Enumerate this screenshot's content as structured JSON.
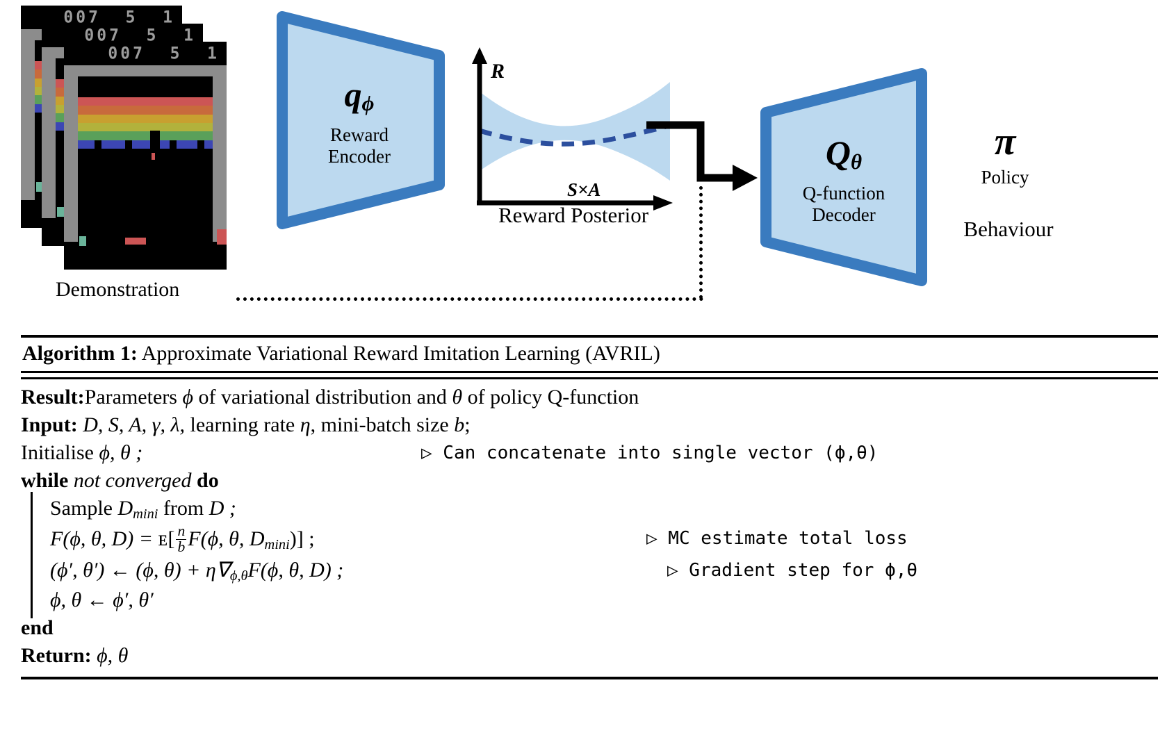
{
  "diagram": {
    "demonstration": {
      "label": "Demonstration",
      "frames": [
        {
          "score": "007  5  1"
        },
        {
          "score": "007  5  1"
        },
        {
          "score": "007  5  1"
        }
      ],
      "brick_colors": [
        "#cc5555",
        "#c86a3c",
        "#c8a030",
        "#b2b23c",
        "#5aa05a",
        "#3c46b4"
      ],
      "game": "Breakout"
    },
    "encoder": {
      "symbol": "q",
      "subscript": "ϕ",
      "line1": "Reward",
      "line2": "Encoder",
      "border_color": "#3a7bbf",
      "fill_color": "#bcd9ef"
    },
    "posterior": {
      "y_axis_label": "R",
      "x_axis_label": "S×A",
      "caption": "Reward Posterior",
      "band_color": "#bcd9ef",
      "mean_color": "#2c4f9e"
    },
    "decoder": {
      "symbol": "Q",
      "subscript": "θ",
      "line1": "Q-function",
      "line2": "Decoder",
      "border_color": "#3a7bbf",
      "fill_color": "#bcd9ef"
    },
    "policy": {
      "symbol": "π",
      "label": "Policy",
      "behaviour": "Behaviour"
    }
  },
  "algorithm": {
    "title_prefix": "Algorithm 1:",
    "title_text": "Approximate Variational Reward Imitation Learning (AVRIL)",
    "lines": {
      "result_kw": "Result:",
      "result_a": "Parameters ",
      "result_phi": "ϕ",
      "result_b": " of variational distribution and ",
      "result_theta": "θ",
      "result_c": " of policy Q-function",
      "input_kw": "Input:",
      "input_sets": "D, S, A, γ, λ,",
      "input_rate": " learning rate ",
      "input_eta": "η",
      "input_batch": ", mini-batch size ",
      "input_b": "b",
      "input_semi": ";",
      "init_text": "Initialise ",
      "init_params": "ϕ, θ ;",
      "init_comment": "▷ Can concatenate into single vector (ϕ,θ)",
      "while_kw": "while",
      "while_cond": "not converged",
      "do_kw": "do",
      "sample_a": "Sample ",
      "sample_D": "D",
      "sample_sub": "mini",
      "sample_b": " from ",
      "sample_D2": "D ;",
      "loss_lhs": "F(ϕ, θ, D) = ",
      "loss_E": "ᴇ",
      "loss_frac_num": "n",
      "loss_frac_den": "b",
      "loss_rhs": "F(ϕ, θ, D",
      "loss_rhs_sub": "mini",
      "loss_end": ")] ;",
      "loss_comment": "▷ MC estimate total loss",
      "grad_lhs": "(ϕ′, θ′) ← (ϕ, θ) + η∇",
      "grad_sub": "ϕ,θ",
      "grad_rhs": "F(ϕ, θ, D) ;",
      "grad_comment": "▷ Gradient step for ϕ,θ",
      "assign": "ϕ, θ ← ϕ′, θ′",
      "end_kw": "end",
      "return_kw": "Return:",
      "return_params": " ϕ, θ"
    }
  }
}
